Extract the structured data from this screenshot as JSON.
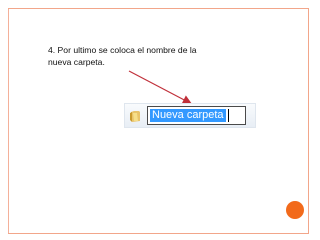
{
  "slide": {
    "caption": "4. Por ultimo se coloca el nombre de la nueva carpeta."
  },
  "explorer": {
    "folder_name_value": "Nueva carpeta",
    "folder_icon": "folder-icon"
  },
  "colors": {
    "frame_border": "#f2a68a",
    "selection": "#3399ff",
    "arrow": "#c0303a",
    "accent_dot": "#f26a1b"
  }
}
